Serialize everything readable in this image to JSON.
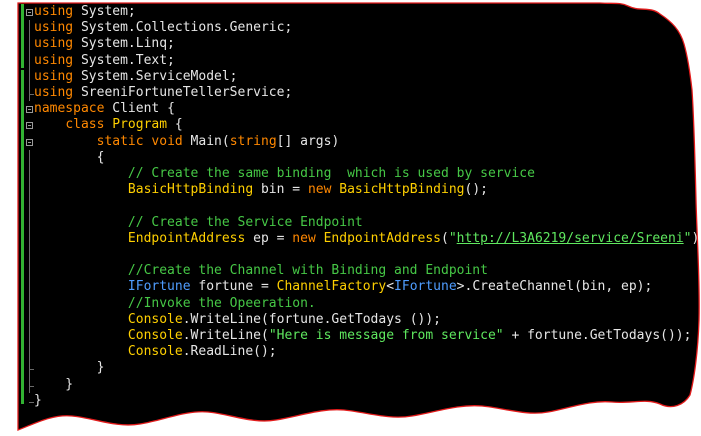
{
  "colors": {
    "editor_background": "#000000",
    "frame_border": "#e21b1b",
    "keyword": "#ff8800",
    "type": "#ffd000",
    "interface": "#4f9dff",
    "comment": "#46c846",
    "string": "#5fe85f",
    "plain": "#e6e6e6",
    "change_bar": "#32b232"
  },
  "code": {
    "lines": [
      {
        "tokens": [
          {
            "k": "kw",
            "t": "using"
          },
          {
            "k": "plain",
            "t": " System;"
          }
        ]
      },
      {
        "tokens": [
          {
            "k": "kw",
            "t": "using"
          },
          {
            "k": "plain",
            "t": " System.Collections.Generic;"
          }
        ]
      },
      {
        "tokens": [
          {
            "k": "kw",
            "t": "using"
          },
          {
            "k": "plain",
            "t": " System.Linq;"
          }
        ]
      },
      {
        "tokens": [
          {
            "k": "kw",
            "t": "using"
          },
          {
            "k": "plain",
            "t": " System.Text;"
          }
        ]
      },
      {
        "tokens": [
          {
            "k": "kw",
            "t": "using"
          },
          {
            "k": "plain",
            "t": " System.ServiceModel;"
          }
        ]
      },
      {
        "tokens": [
          {
            "k": "kw",
            "t": "using"
          },
          {
            "k": "plain",
            "t": " SreeniFortuneTellerService;"
          }
        ]
      },
      {
        "tokens": [
          {
            "k": "kw",
            "t": "namespace"
          },
          {
            "k": "plain",
            "t": " Client {"
          }
        ]
      },
      {
        "tokens": [
          {
            "k": "plain",
            "t": "    "
          },
          {
            "k": "kw",
            "t": "class"
          },
          {
            "k": "plain",
            "t": " "
          },
          {
            "k": "type",
            "t": "Program"
          },
          {
            "k": "plain",
            "t": " {"
          }
        ]
      },
      {
        "tokens": [
          {
            "k": "plain",
            "t": "        "
          },
          {
            "k": "kw",
            "t": "static"
          },
          {
            "k": "plain",
            "t": " "
          },
          {
            "k": "kw",
            "t": "void"
          },
          {
            "k": "plain",
            "t": " Main("
          },
          {
            "k": "kw",
            "t": "string"
          },
          {
            "k": "plain",
            "t": "[] args)"
          }
        ]
      },
      {
        "tokens": [
          {
            "k": "plain",
            "t": "        {"
          }
        ]
      },
      {
        "tokens": [
          {
            "k": "plain",
            "t": "            "
          },
          {
            "k": "cmt",
            "t": "// Create the same binding  which is used by service"
          }
        ]
      },
      {
        "tokens": [
          {
            "k": "plain",
            "t": "            "
          },
          {
            "k": "type",
            "t": "BasicHttpBinding"
          },
          {
            "k": "plain",
            "t": " bin = "
          },
          {
            "k": "kw",
            "t": "new"
          },
          {
            "k": "plain",
            "t": " "
          },
          {
            "k": "type",
            "t": "BasicHttpBinding"
          },
          {
            "k": "plain",
            "t": "();"
          }
        ]
      },
      {
        "tokens": []
      },
      {
        "tokens": [
          {
            "k": "plain",
            "t": "            "
          },
          {
            "k": "cmt",
            "t": "// Create the Service Endpoint"
          }
        ]
      },
      {
        "tokens": [
          {
            "k": "plain",
            "t": "            "
          },
          {
            "k": "type",
            "t": "EndpointAddress"
          },
          {
            "k": "plain",
            "t": " ep = "
          },
          {
            "k": "kw",
            "t": "new"
          },
          {
            "k": "plain",
            "t": " "
          },
          {
            "k": "type",
            "t": "EndpointAddress"
          },
          {
            "k": "plain",
            "t": "("
          },
          {
            "k": "str",
            "t": "\""
          },
          {
            "k": "url",
            "t": "http://L3A6219/service/Sreeni"
          },
          {
            "k": "str",
            "t": "\""
          },
          {
            "k": "plain",
            "t": ");"
          }
        ]
      },
      {
        "tokens": []
      },
      {
        "tokens": [
          {
            "k": "plain",
            "t": "            "
          },
          {
            "k": "cmt",
            "t": "//Create the Channel with Binding and Endpoint"
          }
        ]
      },
      {
        "tokens": [
          {
            "k": "plain",
            "t": "            "
          },
          {
            "k": "iface",
            "t": "IFortune"
          },
          {
            "k": "plain",
            "t": " fortune = "
          },
          {
            "k": "type",
            "t": "ChannelFactory"
          },
          {
            "k": "plain",
            "t": "<"
          },
          {
            "k": "iface",
            "t": "IFortune"
          },
          {
            "k": "plain",
            "t": ">.CreateChannel(bin, ep);"
          }
        ]
      },
      {
        "tokens": [
          {
            "k": "plain",
            "t": "            "
          },
          {
            "k": "cmt",
            "t": "//Invoke the Opeeration."
          }
        ]
      },
      {
        "tokens": [
          {
            "k": "plain",
            "t": "            "
          },
          {
            "k": "type",
            "t": "Console"
          },
          {
            "k": "plain",
            "t": ".WriteLine(fortune.GetTodays ());"
          }
        ]
      },
      {
        "tokens": [
          {
            "k": "plain",
            "t": "            "
          },
          {
            "k": "type",
            "t": "Console"
          },
          {
            "k": "plain",
            "t": ".WriteLine("
          },
          {
            "k": "str",
            "t": "\"Here is message from service\""
          },
          {
            "k": "plain",
            "t": " + fortune.GetTodays());"
          }
        ]
      },
      {
        "tokens": [
          {
            "k": "plain",
            "t": "            "
          },
          {
            "k": "type",
            "t": "Console"
          },
          {
            "k": "plain",
            "t": ".ReadLine();"
          }
        ]
      },
      {
        "tokens": [
          {
            "k": "plain",
            "t": "        }"
          }
        ]
      },
      {
        "tokens": [
          {
            "k": "plain",
            "t": "    }"
          }
        ]
      },
      {
        "tokens": [
          {
            "k": "plain",
            "t": "}"
          }
        ]
      }
    ]
  }
}
